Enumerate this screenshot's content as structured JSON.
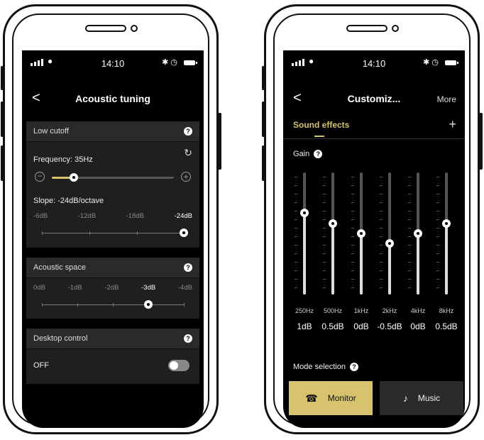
{
  "left_screen": {
    "status": {
      "time": "14:10"
    },
    "nav": {
      "back": "<",
      "title": "Acoustic tuning"
    },
    "low_cutoff": {
      "header": "Low cutoff",
      "frequency_label": "Frequency: 35Hz",
      "frequency_level": 0.18,
      "slope_label": "Slope: -24dB/octave",
      "slope_options": [
        "-6dB",
        "-12dB",
        "-18dB",
        "-24dB"
      ],
      "slope_selected": "-24dB"
    },
    "acoustic_space": {
      "header": "Acoustic space",
      "options": [
        "0dB",
        "-1dB",
        "-2dB",
        "-3dB",
        "-4dB"
      ],
      "selected": "-3dB"
    },
    "desktop_control": {
      "header": "Desktop control",
      "value": "OFF"
    }
  },
  "right_screen": {
    "status": {
      "time": "14:10"
    },
    "nav": {
      "back": "<",
      "title": "Customiz...",
      "more": "More"
    },
    "tab": {
      "label": "Sound effects",
      "add": "+"
    },
    "gain": {
      "label": "Gain",
      "bands": [
        {
          "freq": "250Hz",
          "value": "1dB",
          "level": 0.67
        },
        {
          "freq": "500Hz",
          "value": "0.5dB",
          "level": 0.58
        },
        {
          "freq": "1kHz",
          "value": "0dB",
          "level": 0.5
        },
        {
          "freq": "2kHz",
          "value": "-0.5dB",
          "level": 0.42
        },
        {
          "freq": "4kHz",
          "value": "0dB",
          "level": 0.5
        },
        {
          "freq": "8kHz",
          "value": "0.5dB",
          "level": 0.58
        }
      ]
    },
    "mode": {
      "label": "Mode selection",
      "options": [
        {
          "label": "Monitor",
          "active": true
        },
        {
          "label": "Music",
          "active": false
        }
      ]
    }
  },
  "colors": {
    "accent": "#d7c26e",
    "background": "#000000",
    "card": "#1f1f1f"
  }
}
